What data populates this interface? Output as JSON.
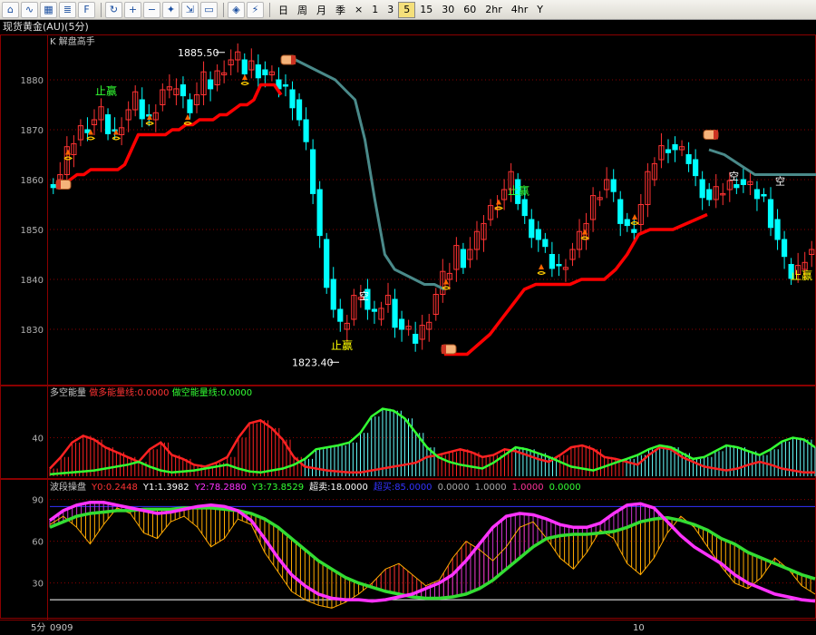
{
  "toolbar": {
    "icons": [
      "menu-icon",
      "line-chart-icon",
      "grid-icon",
      "list-icon",
      "f10-icon",
      "refresh-icon",
      "zoom-in-icon",
      "zoom-out-icon",
      "bookmark-icon",
      "export-icon",
      "window-icon",
      "pin-icon",
      "alert-icon"
    ],
    "periods": [
      "日",
      "周",
      "月",
      "季",
      "×",
      "1",
      "3",
      "5",
      "15",
      "30",
      "60",
      "2hr",
      "4hr",
      "Y"
    ],
    "active_period": "5"
  },
  "instrument_title": "现货黄金(AU)(5分)",
  "main_panel": {
    "label": "K 解盘高手",
    "annotations": {
      "high_price": "1885.50",
      "low_price": "1823.40",
      "take_profit": "止赢",
      "short_marker": "空"
    }
  },
  "volume_panel": {
    "name": "多空能量",
    "long_label": "做多能量线:0.0000",
    "short_label": "做空能量线:0.0000"
  },
  "osc_panel": {
    "name": "波段操盘",
    "values": [
      {
        "text": "Y0:0.2448",
        "color": "#ff3333"
      },
      {
        "text": "Y1:1.3982",
        "color": "#ffffff"
      },
      {
        "text": "Y2:78.2880",
        "color": "#ff33ff"
      },
      {
        "text": "Y3:73.8529",
        "color": "#33ff33"
      },
      {
        "text": "超卖:18.0000",
        "color": "#ffffff"
      },
      {
        "text": "超买:85.0000",
        "color": "#3333ff"
      },
      {
        "text": "0.0000",
        "color": "#aaaaaa"
      },
      {
        "text": "1.0000",
        "color": "#aaaaaa"
      },
      {
        "text": "1.0000",
        "color": "#ff3399"
      },
      {
        "text": "0.0000",
        "color": "#33ff33"
      }
    ]
  },
  "footer": {
    "period": "5分",
    "date_left": "0909",
    "date_mid": "10"
  },
  "colors": {
    "up": "#ff3333",
    "down": "#00ffff",
    "support": "#ff0000",
    "resistance": "#4a8a8a",
    "magenta": "#ff33ff",
    "green": "#33dd33",
    "axis": "#b0b0b0",
    "grid": "#8b0000"
  },
  "chart_data": [
    {
      "type": "candlestick",
      "title": "K 解盘高手",
      "ylim": [
        1820,
        1888
      ],
      "y_ticks": [
        1830,
        1840,
        1850,
        1860,
        1870,
        1880
      ],
      "close_series": [
        1860,
        1861,
        1865,
        1868,
        1870,
        1871,
        1872,
        1873,
        1870,
        1869,
        1872,
        1874,
        1876,
        1873,
        1872,
        1875,
        1878,
        1877,
        1879,
        1876,
        1875,
        1877,
        1880,
        1879,
        1881,
        1883,
        1884,
        1884,
        1882,
        1883,
        1882,
        1881,
        1880,
        1879,
        1878,
        1876,
        1872,
        1866,
        1858,
        1848,
        1840,
        1834,
        1830,
        1832,
        1836,
        1838,
        1834,
        1832,
        1835,
        1836,
        1832,
        1830,
        1829,
        1828,
        1830,
        1833,
        1837,
        1840,
        1842,
        1846,
        1844,
        1846,
        1848,
        1852,
        1854,
        1856,
        1858,
        1860,
        1856,
        1852,
        1850,
        1848,
        1845,
        1843,
        1842,
        1844,
        1846,
        1848,
        1852,
        1856,
        1858,
        1860,
        1856,
        1852,
        1850,
        1851,
        1855,
        1860,
        1864,
        1866,
        1867,
        1866,
        1865,
        1864,
        1860,
        1858,
        1856,
        1857,
        1858,
        1859,
        1860,
        1859,
        1858,
        1857,
        1856,
        1852,
        1848,
        1843,
        1841,
        1842,
        1845,
        1846
      ],
      "support_line": [
        1859,
        1860,
        1861,
        1861,
        1862,
        1862,
        1862,
        1862,
        1862,
        1863,
        1866,
        1869,
        1869,
        1869,
        1869,
        1869,
        1870,
        1870,
        1871,
        1871,
        1872,
        1872,
        1872,
        1873,
        1873,
        1874,
        1875,
        1875,
        1876,
        1879,
        1879,
        1879,
        1877
      ],
      "resistance_line": [
        1884,
        1884,
        1883,
        1882,
        1881,
        1880,
        1878,
        1876,
        1868,
        1856,
        1845,
        1842,
        1841,
        1840,
        1839,
        1839,
        1838
      ],
      "resistance_line_2": [
        1866,
        1865,
        1863,
        1861,
        1861,
        1861,
        1861,
        1861
      ],
      "support_line_2": [
        1825,
        1825,
        1825,
        1827,
        1829,
        1832,
        1835,
        1838,
        1839,
        1839,
        1839,
        1839,
        1840,
        1840,
        1840,
        1842,
        1845,
        1849,
        1850,
        1850,
        1850,
        1851,
        1852,
        1853
      ]
    },
    {
      "type": "area",
      "title": "多空能量",
      "ylim": [
        0,
        80
      ],
      "y_ticks": [
        40
      ],
      "series": [
        {
          "name": "做多能量线",
          "values": [
            8,
            20,
            35,
            42,
            38,
            30,
            25,
            20,
            15,
            28,
            35,
            22,
            18,
            12,
            10,
            14,
            20,
            40,
            55,
            58,
            50,
            38,
            20,
            10,
            8,
            6,
            5,
            4,
            4,
            6,
            8,
            10,
            12,
            14,
            20,
            22,
            25,
            28,
            25,
            20,
            22,
            28,
            26,
            22,
            18,
            15,
            22,
            30,
            32,
            28,
            20,
            18,
            15,
            12,
            22,
            30,
            28,
            20,
            15,
            10,
            8,
            6,
            8,
            12,
            15,
            12,
            8,
            6,
            4,
            4
          ]
        },
        {
          "name": "做空能量线",
          "values": [
            2,
            3,
            4,
            5,
            6,
            8,
            10,
            12,
            15,
            10,
            6,
            4,
            5,
            6,
            8,
            10,
            12,
            8,
            5,
            4,
            6,
            8,
            12,
            18,
            28,
            30,
            32,
            35,
            45,
            62,
            70,
            68,
            60,
            45,
            30,
            20,
            15,
            12,
            10,
            8,
            14,
            22,
            30,
            28,
            24,
            20,
            15,
            10,
            8,
            6,
            10,
            14,
            18,
            22,
            28,
            32,
            30,
            24,
            18,
            20,
            26,
            32,
            30,
            26,
            22,
            28,
            36,
            40,
            38,
            30
          ]
        }
      ]
    },
    {
      "type": "line",
      "title": "波段操盘",
      "ylim": [
        5,
        95
      ],
      "y_ticks": [
        30,
        60,
        90
      ],
      "overbought": 85,
      "oversold": 18,
      "series": [
        {
          "name": "Y2",
          "values": [
            75,
            82,
            86,
            88,
            88,
            86,
            84,
            82,
            80,
            81,
            83,
            85,
            86,
            85,
            82,
            75,
            62,
            48,
            36,
            28,
            22,
            19,
            18,
            18,
            17,
            18,
            20,
            22,
            26,
            30,
            36,
            46,
            58,
            70,
            78,
            80,
            79,
            76,
            72,
            70,
            70,
            73,
            80,
            86,
            87,
            84,
            74,
            64,
            56,
            50,
            44,
            36,
            30,
            26,
            22,
            20,
            18,
            17
          ]
        },
        {
          "name": "Y3",
          "values": [
            70,
            74,
            78,
            80,
            81,
            82,
            82,
            83,
            83,
            83,
            84,
            84,
            84,
            83,
            82,
            80,
            76,
            70,
            62,
            54,
            46,
            40,
            34,
            30,
            27,
            24,
            22,
            20,
            19,
            19,
            20,
            22,
            26,
            32,
            40,
            48,
            56,
            62,
            64,
            65,
            65,
            66,
            67,
            70,
            74,
            76,
            77,
            75,
            72,
            68,
            62,
            58,
            52,
            48,
            44,
            40,
            36,
            33
          ]
        },
        {
          "name": "Y1",
          "values": [
            72,
            78,
            70,
            58,
            72,
            84,
            80,
            66,
            62,
            74,
            78,
            70,
            56,
            62,
            76,
            72,
            52,
            38,
            24,
            18,
            14,
            12,
            16,
            22,
            30,
            40,
            44,
            36,
            28,
            32,
            48,
            60,
            54,
            46,
            56,
            70,
            74,
            62,
            48,
            40,
            52,
            68,
            62,
            44,
            36,
            48,
            66,
            78,
            70,
            56,
            42,
            30,
            26,
            34,
            48,
            40,
            28,
            22
          ]
        }
      ]
    }
  ]
}
